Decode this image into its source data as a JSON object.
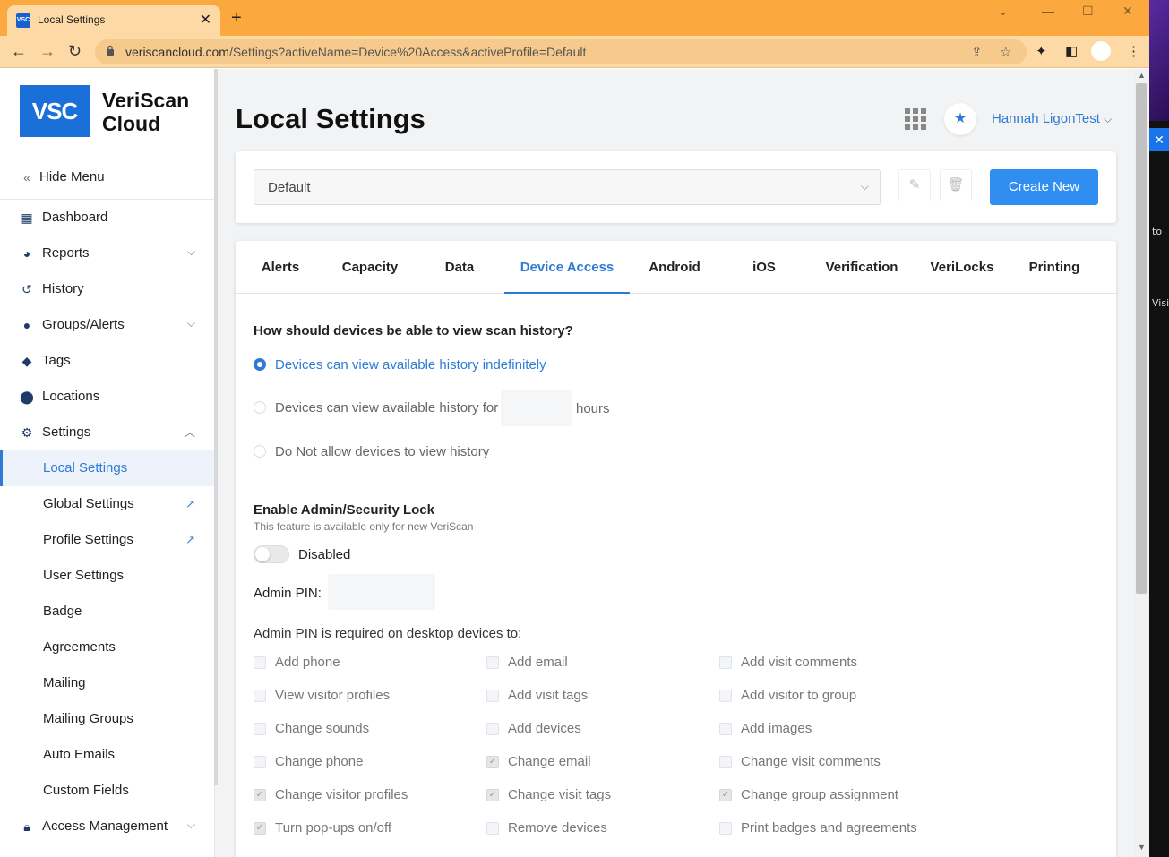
{
  "browser": {
    "tab_title": "Local Settings",
    "favicon_text": "VSC",
    "tab_close": "✕",
    "new_tab": "+",
    "url_host": "veriscancloud.com",
    "url_path": "/Settings?activeName=Device%20Access&activeProfile=Default"
  },
  "right_strip": {
    "close": "✕",
    "t1": "to",
    "t2": "Visi"
  },
  "sidebar": {
    "logo": "VSC",
    "brand_line1": "VeriScan",
    "brand_line2": "Cloud",
    "hide_menu": "Hide Menu",
    "items": [
      {
        "label": "Dashboard"
      },
      {
        "label": "Reports"
      },
      {
        "label": "History"
      },
      {
        "label": "Groups/Alerts"
      },
      {
        "label": "Tags"
      },
      {
        "label": "Locations"
      },
      {
        "label": "Settings"
      }
    ],
    "settings_sub": [
      {
        "label": "Local Settings"
      },
      {
        "label": "Global Settings"
      },
      {
        "label": "Profile Settings"
      },
      {
        "label": "User Settings"
      },
      {
        "label": "Badge"
      },
      {
        "label": "Agreements"
      },
      {
        "label": "Mailing"
      },
      {
        "label": "Mailing Groups"
      },
      {
        "label": "Auto Emails"
      },
      {
        "label": "Custom Fields"
      }
    ],
    "access_management": "Access Management"
  },
  "header": {
    "title": "Local Settings",
    "user_name": "Hannah LigonTest"
  },
  "profile": {
    "selected": "Default",
    "create_new": "Create New"
  },
  "tabs": [
    "Alerts",
    "Capacity",
    "Data",
    "Device Access",
    "Android",
    "iOS",
    "Verification",
    "VeriLocks",
    "Printing"
  ],
  "active_tab": "Device Access",
  "history": {
    "question": "How should devices be able to view scan history?",
    "opt1": "Devices can view available history indefinitely",
    "opt2": "Devices can view available history for",
    "opt2_unit": "hours",
    "opt3": "Do Not allow devices to view history"
  },
  "lock": {
    "title": "Enable Admin/Security Lock",
    "note": "This feature is available only for new VeriScan",
    "toggle_label": "Disabled",
    "pin_label": "Admin PIN:",
    "required_label": "Admin PIN is required on desktop devices to:"
  },
  "checkboxes": [
    [
      {
        "label": "Add phone",
        "checked": false
      },
      {
        "label": "Add email",
        "checked": false
      },
      {
        "label": "Add visit comments",
        "checked": false
      }
    ],
    [
      {
        "label": "View visitor profiles",
        "checked": false
      },
      {
        "label": "Add visit tags",
        "checked": false
      },
      {
        "label": "Add visitor to group",
        "checked": false
      }
    ],
    [
      {
        "label": "Change sounds",
        "checked": false
      },
      {
        "label": "Add devices",
        "checked": false
      },
      {
        "label": "Add images",
        "checked": false
      }
    ],
    [
      {
        "label": "Change phone",
        "checked": false
      },
      {
        "label": "Change email",
        "checked": true
      },
      {
        "label": "Change visit comments",
        "checked": false
      }
    ],
    [
      {
        "label": "Change visitor profiles",
        "checked": true
      },
      {
        "label": "Change visit tags",
        "checked": true
      },
      {
        "label": "Change group assignment",
        "checked": true
      }
    ],
    [
      {
        "label": "Turn pop-ups on/off",
        "checked": true
      },
      {
        "label": "Remove devices",
        "checked": false
      },
      {
        "label": "Print badges and agreements",
        "checked": false
      }
    ]
  ],
  "colors": {
    "accent": "#2e7bd6",
    "button": "#2f8ef0",
    "tabbar": "#fba93e"
  }
}
